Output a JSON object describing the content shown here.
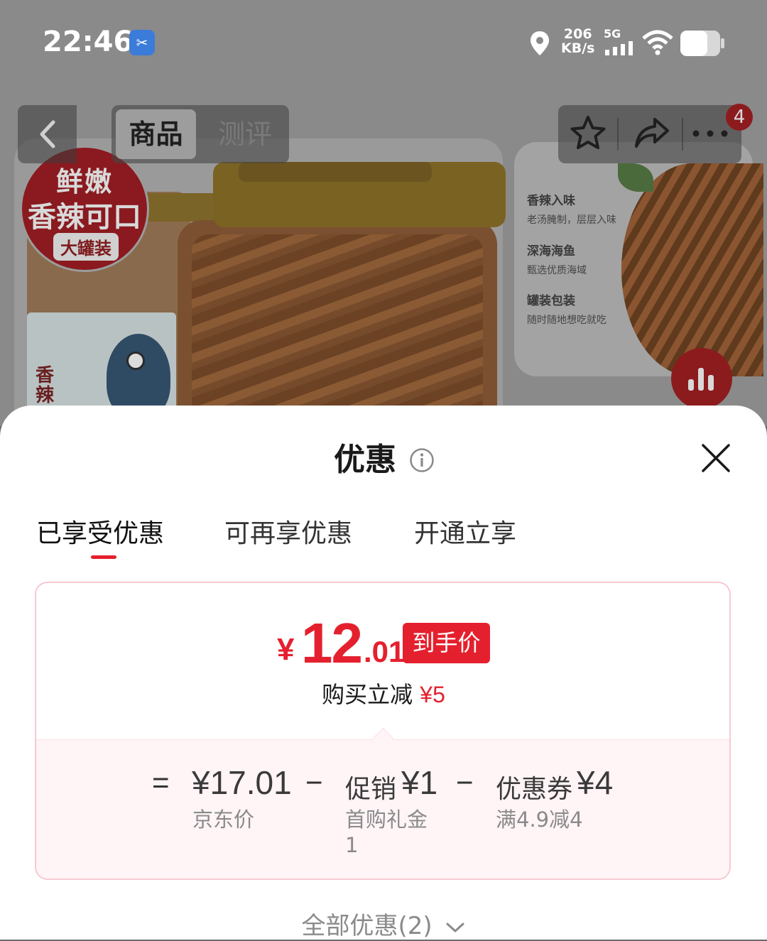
{
  "status_bar": {
    "time": "22:46",
    "net_speed_value": "206",
    "net_speed_unit": "KB/s",
    "network": "5G",
    "icons": [
      "screen-cast-icon",
      "location-icon",
      "signal-icon",
      "wifi-icon",
      "battery-icon"
    ]
  },
  "nav": {
    "tabs": [
      "商品",
      "测评"
    ],
    "active_tab": "商品",
    "badge_count": "4",
    "icons": [
      "back-icon",
      "star-icon",
      "share-icon",
      "more-icon"
    ]
  },
  "product_background": {
    "seal_line1": "鲜嫩",
    "seal_line2": "香辣可口",
    "seal_tag": "大罐装",
    "jar_label": "香辣",
    "features": [
      {
        "title": "香辣入味",
        "desc": "老汤腌制，层层入味"
      },
      {
        "title": "深海海鱼",
        "desc": "甄选优质海域"
      },
      {
        "title": "罐装包装",
        "desc": "随时随地想吃就吃"
      }
    ]
  },
  "sheet": {
    "title": "优惠",
    "tabs": [
      "已享受优惠",
      "可再享优惠",
      "开通立享"
    ],
    "active_tab_index": 0,
    "final_price": {
      "currency": "¥",
      "integer": "12",
      "decimal": ".01",
      "tag": "到手价"
    },
    "purchase_reduce_label": "购买立减",
    "purchase_reduce_value": "¥5",
    "breakdown": {
      "equals": "=",
      "minus": "−",
      "items": [
        {
          "amount": "¥17.01",
          "label": "京东价"
        },
        {
          "name": "促销",
          "amount": "¥1",
          "label": "首购礼金",
          "label2": "1"
        },
        {
          "name": "优惠券",
          "amount": "¥4",
          "label": "满4.9减4"
        }
      ]
    },
    "all_offers": "全部优惠(2)",
    "colors": {
      "accent": "#e5202e",
      "card_border": "#f7c9d2",
      "card_lower_bg": "#fff4f6"
    }
  }
}
